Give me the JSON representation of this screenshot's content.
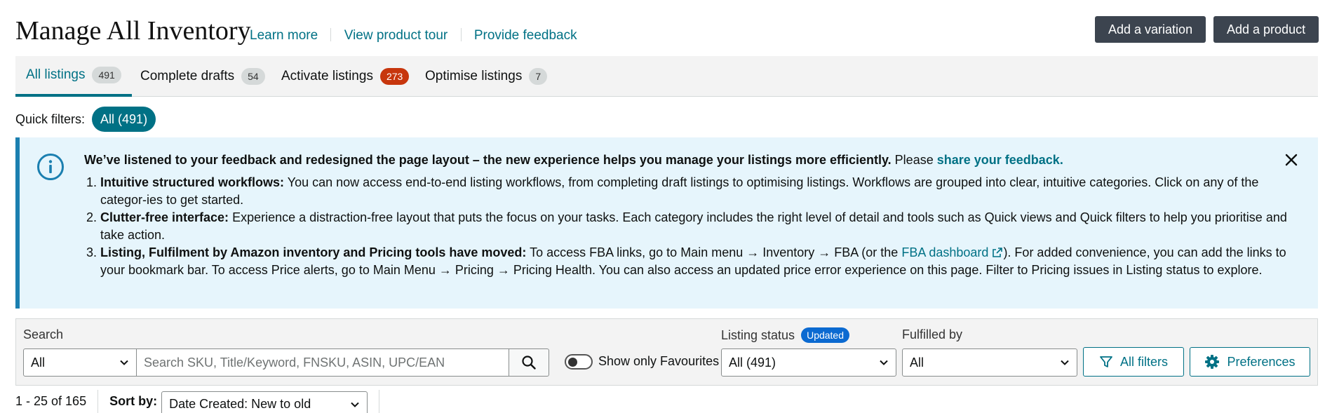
{
  "header": {
    "title": "Manage All Inventory",
    "links": [
      "Learn more",
      "View product tour",
      "Provide feedback"
    ],
    "add_variation_label": "Add a variation",
    "add_product_label": "Add a product"
  },
  "tabs": [
    {
      "label": "All listings",
      "count": "491",
      "active": true
    },
    {
      "label": "Complete drafts",
      "count": "54"
    },
    {
      "label": "Activate listings",
      "count": "273",
      "alert": true
    },
    {
      "label": "Optimise listings",
      "count": "7"
    }
  ],
  "quick_filters": {
    "label": "Quick filters:",
    "chip": "All (491)"
  },
  "banner": {
    "headline_bold": "We’ve listened to your feedback and redesigned the page layout – the new experience helps you manage your listings more efficiently.",
    "headline_tail": "Please",
    "headline_link": "share your feedback.",
    "items": [
      {
        "title": "Intuitive structured workflows:",
        "text": "You can now access end-to-end listing workflows, from completing draft listings to optimising listings. Workflows are grouped into clear, intuitive categories. Click on any of the categor-ies to get started."
      },
      {
        "title": "Clutter-free interface:",
        "text": "Experience a distraction-free layout that puts the focus on your tasks. Each category includes the right level of detail and tools such as Quick views and Quick filters to help you prioritise and take action."
      },
      {
        "title": "Listing, Fulfilment by Amazon inventory and Pricing tools have moved:",
        "text_before": "To access FBA links, go to Main menu → Inventory → FBA (or the",
        "link": "FBA dashboard",
        "text_after": "). For added convenience, you can add the links to your bookmark bar. To access Price alerts, go to Main Menu → Pricing → Pricing Health. You can also access an updated price error experience on this page. Filter to Pricing issues in Listing status to explore."
      }
    ]
  },
  "filters": {
    "search_label": "Search",
    "search_scope": "All",
    "search_placeholder": "Search SKU, Title/Keyword, FNSKU, ASIN, UPC/EAN",
    "favourites_label": "Show only Favourites",
    "favourites_on": false,
    "listing_status_label": "Listing status",
    "listing_status_badge": "Updated",
    "listing_status_value": "All (491)",
    "fulfilled_by_label": "Fulfilled by",
    "fulfilled_by_value": "All",
    "all_filters_label": "All filters",
    "preferences_label": "Preferences"
  },
  "results": {
    "range": "1 - 25 of 165",
    "sort_label": "Sort by:",
    "sort_value": "Date Created: New to old"
  }
}
